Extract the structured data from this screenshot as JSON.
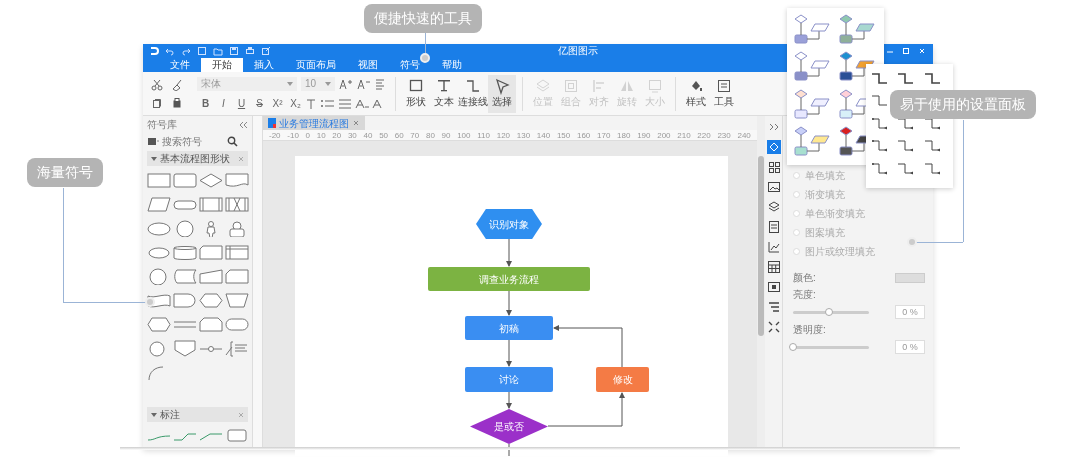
{
  "callouts": [
    {
      "text": "便捷快速的工具"
    },
    {
      "text": "海量符号"
    },
    {
      "text": "易于使用的设置面板"
    }
  ],
  "window": {
    "title": "亿图图示"
  },
  "ribbon_tabs": [
    {
      "label": "文件",
      "selected": false
    },
    {
      "label": "开始",
      "selected": true
    },
    {
      "label": "插入",
      "selected": false
    },
    {
      "label": "页面布局",
      "selected": false
    },
    {
      "label": "视图",
      "selected": false
    },
    {
      "label": "符号",
      "selected": false
    },
    {
      "label": "帮助",
      "selected": false
    }
  ],
  "toolbar": {
    "font": "宋体",
    "font_size": "10",
    "format_buttons": [
      {
        "glyph": "B",
        "kind": "bold"
      },
      {
        "glyph": "I",
        "kind": "italic"
      },
      {
        "glyph": "U",
        "kind": "underline"
      },
      {
        "glyph": "S",
        "kind": "strike"
      },
      {
        "glyph": "X²",
        "kind": "plain"
      },
      {
        "glyph": "X₂",
        "kind": "plain"
      }
    ],
    "tools": [
      {
        "label": "形状",
        "kind": "shape",
        "disabled": false,
        "selected": false
      },
      {
        "label": "文本",
        "kind": "text",
        "disabled": false,
        "selected": false
      },
      {
        "label": "连接线",
        "kind": "connector",
        "disabled": false,
        "selected": false
      },
      {
        "label": "选择",
        "kind": "select",
        "disabled": false,
        "selected": true
      },
      {
        "label": "位置",
        "kind": "layers",
        "disabled": true,
        "selected": false
      },
      {
        "label": "组合",
        "kind": "group",
        "disabled": true,
        "selected": false
      },
      {
        "label": "对齐",
        "kind": "align",
        "disabled": true,
        "selected": false
      },
      {
        "label": "旋转",
        "kind": "flip",
        "disabled": true,
        "selected": false
      },
      {
        "label": "大小",
        "kind": "size",
        "disabled": true,
        "selected": false
      },
      {
        "label": "样式",
        "kind": "style",
        "disabled": false,
        "selected": false
      },
      {
        "label": "工具",
        "kind": "tools",
        "disabled": false,
        "selected": false
      }
    ]
  },
  "symbol_library": {
    "title": "符号库",
    "search_placeholder": "搜索符号",
    "sections": [
      {
        "title": "基本流程图形状",
        "expanded": true
      },
      {
        "title": "标注",
        "expanded": true
      }
    ]
  },
  "document_tab": {
    "title": "业务管理流程图",
    "selected": true
  },
  "ruler": [
    "-20",
    "-10",
    "0",
    "10",
    "20",
    "30",
    "40",
    "50",
    "60",
    "70",
    "80",
    "90",
    "100",
    "110",
    "120",
    "130",
    "140",
    "150",
    "160",
    "170",
    "180",
    "190",
    "200",
    "210",
    "220",
    "230",
    "240"
  ],
  "diagram": {
    "nodes": [
      {
        "text": "识别对象",
        "kind": "hexagon",
        "color": "#2f8ff0"
      },
      {
        "text": "调查业务流程",
        "kind": "process",
        "color": "#7cb342"
      },
      {
        "text": "初稿",
        "kind": "process",
        "color": "#3a8ef2"
      },
      {
        "text": "讨论",
        "kind": "process",
        "color": "#3a8ef2"
      },
      {
        "text": "修改",
        "kind": "process",
        "color": "#f47b45"
      },
      {
        "text": "是或否",
        "kind": "decision",
        "color": "#9b30c9"
      }
    ]
  },
  "fill_options": [
    {
      "label": "单色填充",
      "selected": false
    },
    {
      "label": "渐变填充",
      "selected": false
    },
    {
      "label": "单色渐变填充",
      "selected": false
    },
    {
      "label": "图案填充",
      "selected": false
    },
    {
      "label": "图片或纹理填充",
      "selected": false
    }
  ],
  "color_label": "颜色:",
  "sliders": [
    {
      "label": "亮度:",
      "level": 0.48,
      "reading": "0 %"
    },
    {
      "label": "透明度:",
      "level": 0,
      "reading": "0 %"
    }
  ]
}
